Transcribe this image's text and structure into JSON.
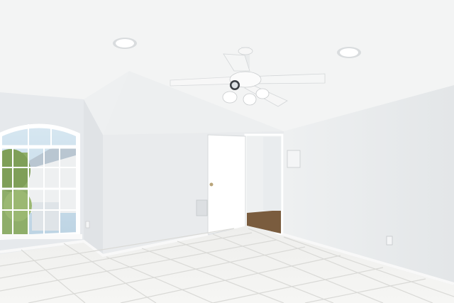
{
  "scene": {
    "kind": "empty-room-photo",
    "objects": [
      "ceiling",
      "recessed-light",
      "ceiling-fan",
      "arched-window",
      "open-door",
      "closet",
      "wall-vent",
      "thermostat",
      "outlet",
      "tile-floor"
    ]
  },
  "watermark": {
    "text": ""
  },
  "colors": {
    "ceiling": "#f3f4f4",
    "wall_back": "#eceef0",
    "wall_right": "#e8eaec",
    "wall_left": "#e4e7ea",
    "door": "#ffffff",
    "closet_floor": "#7a5c3e",
    "tile": "#f0f0ee",
    "grout": "#d9d9d6",
    "sky": "#cfe1ee",
    "foliage": "#8fae6a"
  }
}
